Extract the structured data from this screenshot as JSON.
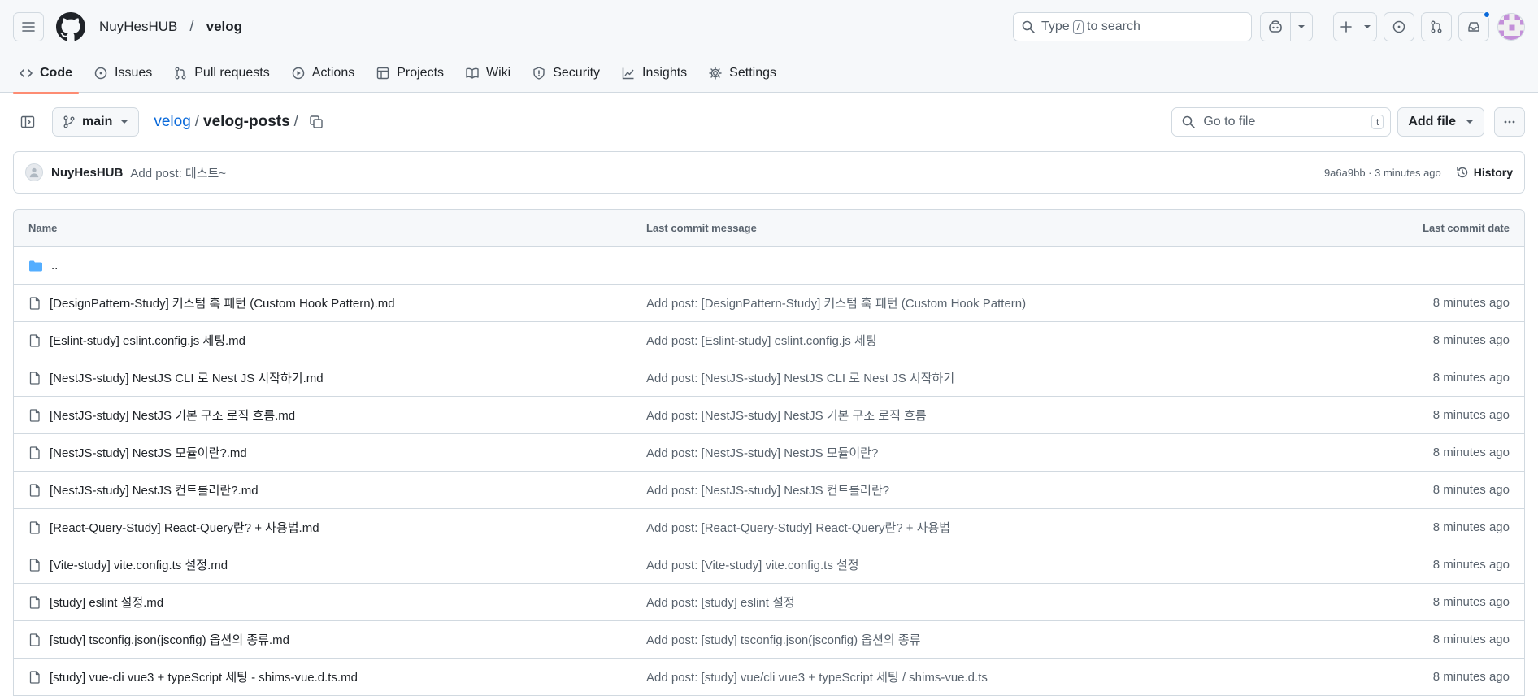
{
  "header": {
    "owner": "NuyHesHUB",
    "separator": "/",
    "repo": "velog",
    "search": {
      "prefix": "Type",
      "key": "/",
      "suffix": "to search"
    }
  },
  "tabs": [
    {
      "label": "Code",
      "icon": "code-icon",
      "active": true
    },
    {
      "label": "Issues",
      "icon": "issue-icon",
      "active": false
    },
    {
      "label": "Pull requests",
      "icon": "pull-request-icon",
      "active": false
    },
    {
      "label": "Actions",
      "icon": "play-icon",
      "active": false
    },
    {
      "label": "Projects",
      "icon": "table-icon",
      "active": false
    },
    {
      "label": "Wiki",
      "icon": "book-icon",
      "active": false
    },
    {
      "label": "Security",
      "icon": "shield-icon",
      "active": false
    },
    {
      "label": "Insights",
      "icon": "graph-icon",
      "active": false
    },
    {
      "label": "Settings",
      "icon": "gear-icon",
      "active": false
    }
  ],
  "toolbar": {
    "branch": "main",
    "path_root": "velog",
    "path_sep": "/",
    "path_current": "velog-posts",
    "path_trailing": "/",
    "goto_placeholder": "Go to file",
    "goto_key": "t",
    "add_file": "Add file"
  },
  "commit": {
    "author": "NuyHesHUB",
    "message": "Add post: 테스트~",
    "meta": "9a6a9bb · 3 minutes ago",
    "history": "History"
  },
  "table": {
    "headers": {
      "name": "Name",
      "message": "Last commit message",
      "date": "Last commit date"
    },
    "parent": "..",
    "rows": [
      {
        "name": "[DesignPattern-Study] 커스텀 훅 패턴 (Custom Hook Pattern).md",
        "message": "Add post: [DesignPattern-Study] 커스텀 훅 패턴 (Custom Hook Pattern)",
        "date": "8 minutes ago"
      },
      {
        "name": "[Eslint-study] eslint.config.js 세팅.md",
        "message": "Add post: [Eslint-study] eslint.config.js 세팅",
        "date": "8 minutes ago"
      },
      {
        "name": "[NestJS-study] NestJS CLI 로 Nest JS 시작하기.md",
        "message": "Add post: [NestJS-study] NestJS CLI 로 Nest JS 시작하기",
        "date": "8 minutes ago"
      },
      {
        "name": "[NestJS-study] NestJS 기본 구조 로직 흐름.md",
        "message": "Add post: [NestJS-study] NestJS 기본 구조 로직 흐름",
        "date": "8 minutes ago"
      },
      {
        "name": "[NestJS-study] NestJS 모듈이란?.md",
        "message": "Add post: [NestJS-study] NestJS 모듈이란?",
        "date": "8 minutes ago"
      },
      {
        "name": "[NestJS-study] NestJS 컨트롤러란?.md",
        "message": "Add post: [NestJS-study] NestJS 컨트롤러란?",
        "date": "8 minutes ago"
      },
      {
        "name": "[React-Query-Study] React-Query란? + 사용법.md",
        "message": "Add post: [React-Query-Study] React-Query란? + 사용법",
        "date": "8 minutes ago"
      },
      {
        "name": "[Vite-study] vite.config.ts 설정.md",
        "message": "Add post: [Vite-study] vite.config.ts 설정",
        "date": "8 minutes ago"
      },
      {
        "name": "[study] eslint 설정.md",
        "message": "Add post: [study] eslint 설정",
        "date": "8 minutes ago"
      },
      {
        "name": "[study] tsconfig.json(jsconfig) 옵션의 종류.md",
        "message": "Add post: [study] tsconfig.json(jsconfig) 옵션의 종류",
        "date": "8 minutes ago"
      },
      {
        "name": "[study] vue-cli vue3 + typeScript 세팅 - shims-vue.d.ts.md",
        "message": "Add post: [study] vue/cli vue3 + typeScript 세팅 / shims-vue.d.ts",
        "date": "8 minutes ago"
      }
    ]
  },
  "colors": {
    "accent": "#0969da",
    "tab_underline": "#fd8c73",
    "folder": "#54aeff",
    "notification": "#0969da"
  }
}
